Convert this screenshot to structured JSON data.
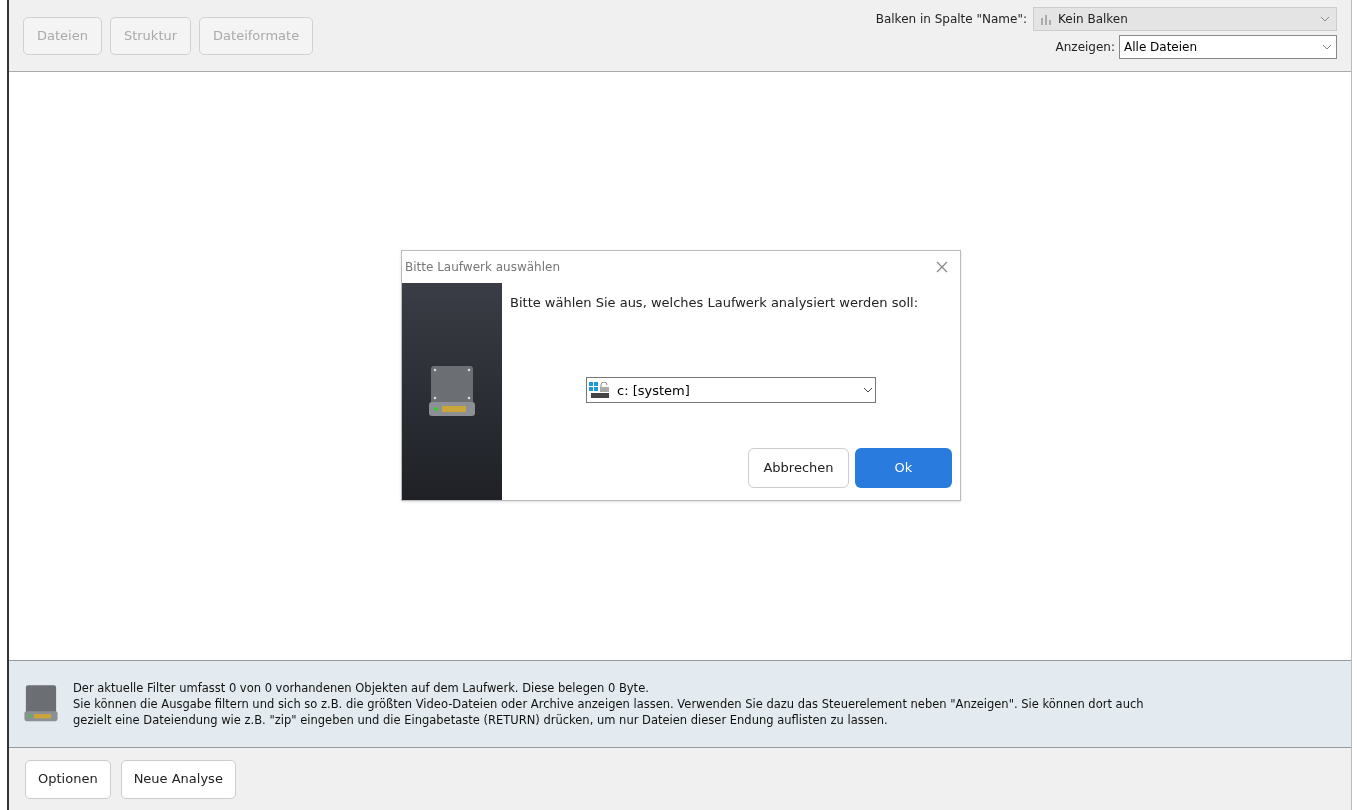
{
  "toolbar": {
    "view_buttons": [
      {
        "label": "Dateien",
        "disabled": true
      },
      {
        "label": "Struktur",
        "disabled": true
      },
      {
        "label": "Dateiformate",
        "disabled": true
      }
    ],
    "bars_label": "Balken in Spalte \"Name\":",
    "bars_select": {
      "value": "Kein Balken",
      "disabled": true
    },
    "show_label": "Anzeigen:",
    "show_select": {
      "value": "Alle Dateien",
      "disabled": false
    }
  },
  "dialog": {
    "title": "Bitte Laufwerk auswählen",
    "prompt": "Bitte wählen Sie aus, welches Laufwerk analysiert werden soll:",
    "drive_select": {
      "value": "c: [system]"
    },
    "buttons": [
      {
        "label": "Abbrechen",
        "kind": "secondary"
      },
      {
        "label": "Ok",
        "kind": "primary"
      }
    ]
  },
  "info": {
    "lines": [
      "Der aktuelle Filter umfasst 0 von 0 vorhandenen Objekten auf dem Laufwerk. Diese belegen 0 Byte.",
      "Sie können die Ausgabe filtern und sich so z.B. die größten Video-Dateien oder Archive anzeigen lassen. Verwenden Sie dazu das Steuerelement neben \"Anzeigen\". Sie können dort auch",
      "gezielt eine Dateiendung wie z.B. \"zip\" eingeben und die Eingabetaste (RETURN) drücken, um nur Dateien dieser Endung auflisten zu lassen."
    ]
  },
  "bottom_buttons": [
    "Optionen",
    "Neue Analyse"
  ]
}
